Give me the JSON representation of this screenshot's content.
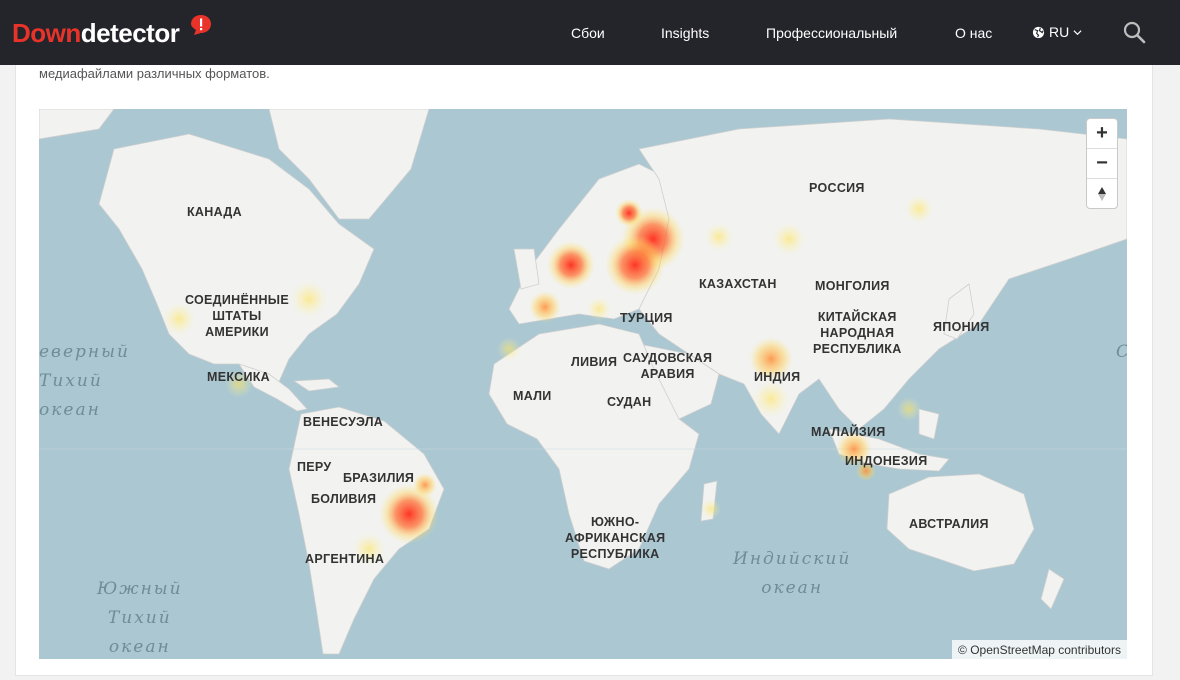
{
  "header": {
    "logo_down": "Down",
    "logo_detector": "detector",
    "nav": [
      "Сбои",
      "Insights",
      "Профессиональный",
      "О нас"
    ],
    "lang": "RU"
  },
  "description": "медиафайлами различных форматов.",
  "map": {
    "countries": [
      "КАНАДА",
      "СОЕДИНЁННЫЕ\nШТАТЫ\nАМЕРИКИ",
      "МЕКСИКА",
      "ВЕНЕСУЭЛА",
      "ПЕРУ",
      "БРАЗИЛИЯ",
      "БОЛИВИЯ",
      "АРГЕНТИНА",
      "РОССИЯ",
      "КАЗАХСТАН",
      "МОНГОЛИЯ",
      "КИТАЙСКАЯ\nНАРОДНАЯ\nРЕСПУБЛИКА",
      "ЯПОНИЯ",
      "ТУРЦИЯ",
      "ЛИВИЯ",
      "САУДОВСКАЯ\nАРАВИЯ",
      "ИНДИЯ",
      "МАЛИ",
      "СУДАН",
      "МАЛАЙЗИЯ",
      "ИНДОНЕЗИЯ",
      "ЮЖНО-\nАФРИКАНСКАЯ\nРЕСПУБЛИКА",
      "АВСТРАЛИЯ"
    ],
    "oceans": [
      "еверный\nТихий\nокеан",
      "Южный\nТихий\nокеан",
      "Индийский\nокеан",
      "С"
    ],
    "attribution": "© OpenStreetMap contributors",
    "zoom_in": "+",
    "zoom_out": "−",
    "reset": "▲"
  }
}
